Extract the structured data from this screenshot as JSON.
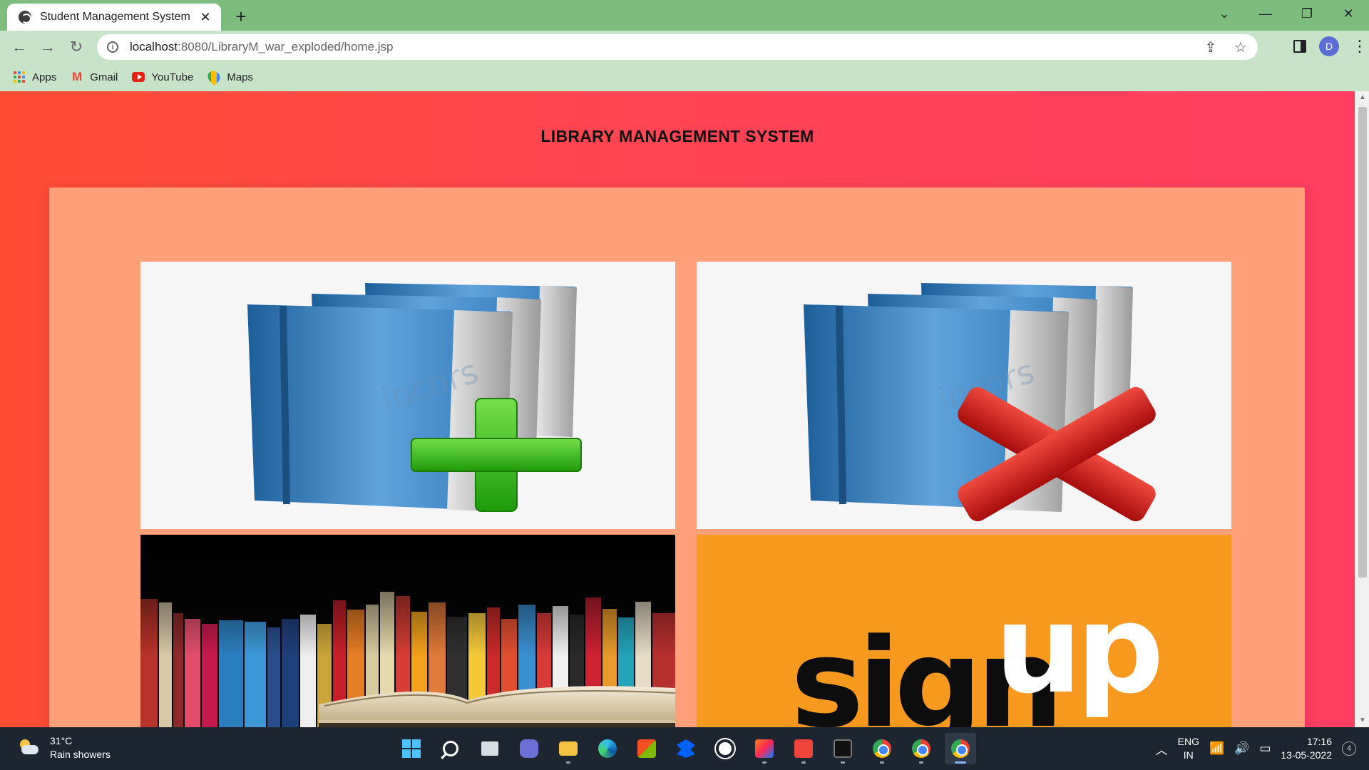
{
  "browser": {
    "tab_title": "Student Management System",
    "tab_close": "✕",
    "new_tab": "+",
    "url_host": "localhost",
    "url_path": ":8080/LibraryM_war_exploded/home.jsp",
    "profile_initial": "D",
    "bookmarks": [
      {
        "label": "Apps",
        "icon": "apps-grid-icon"
      },
      {
        "label": "Gmail",
        "icon": "gmail-icon"
      },
      {
        "label": "YouTube",
        "icon": "youtube-icon"
      },
      {
        "label": "Maps",
        "icon": "maps-icon"
      }
    ]
  },
  "page": {
    "heading": "LIBRARY MANAGEMENT SYSTEM",
    "cards": [
      {
        "id": "add-book",
        "image": "books-with-green-plus"
      },
      {
        "id": "remove-book",
        "image": "books-with-red-x"
      },
      {
        "id": "view-books",
        "image": "bookshelf-photo"
      },
      {
        "id": "signup",
        "image": "signup-logo",
        "logo_text_dark": "sign",
        "logo_text_light": "up"
      }
    ],
    "watermark": "incors"
  },
  "taskbar": {
    "temperature": "31°C",
    "weather": "Rain showers",
    "lang_1": "ENG",
    "lang_2": "IN",
    "time": "17:16",
    "date": "13-05-2022",
    "notifications": "4"
  },
  "colors": {
    "tab_strip": "#7dbb7f",
    "toolbar": "#c7e4c8",
    "page_gradient_start": "#ff4d33",
    "page_gradient_end": "#ff3e62",
    "panel": "#ffa07a",
    "signup_bg": "#f7991f"
  }
}
